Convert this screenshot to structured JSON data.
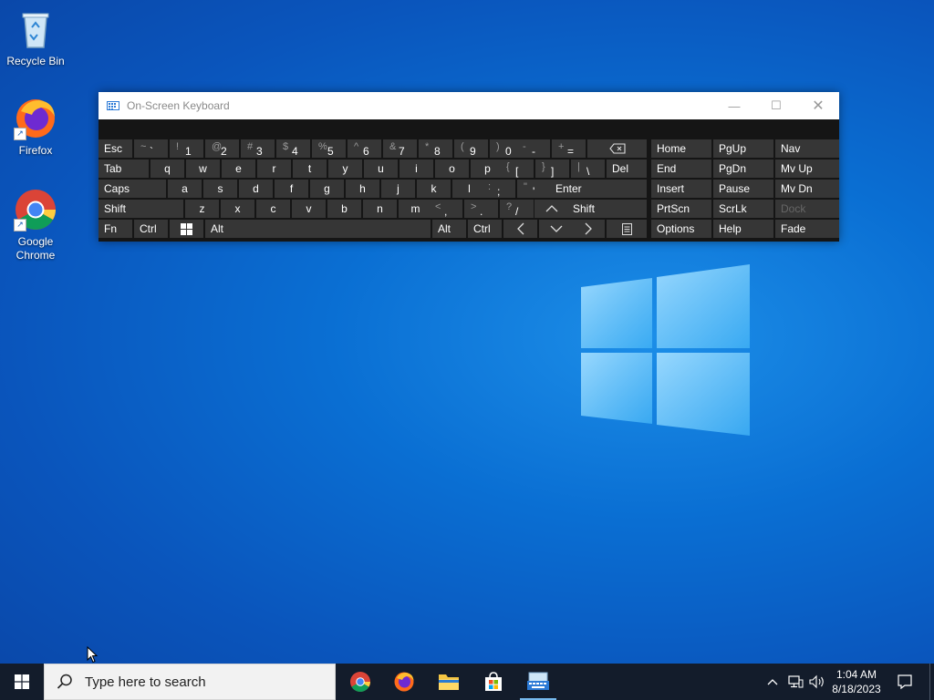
{
  "desktop": {
    "icons": [
      {
        "label": "Recycle Bin"
      },
      {
        "label": "Firefox"
      },
      {
        "label": "Google Chrome"
      }
    ]
  },
  "osk": {
    "title": "On-Screen Keyboard",
    "rows": {
      "r1": {
        "esc": "Esc",
        "tilde": [
          "~",
          "`"
        ],
        "d1": [
          "!",
          "1"
        ],
        "d2": [
          "@",
          "2"
        ],
        "d3": [
          "#",
          "3"
        ],
        "d4": [
          "$",
          "4"
        ],
        "d5": [
          "%",
          "5"
        ],
        "d6": [
          "^",
          "6"
        ],
        "d7": [
          "&",
          "7"
        ],
        "d8": [
          "*",
          "8"
        ],
        "d9": [
          "(",
          "9"
        ],
        "d0": [
          ")",
          "0"
        ],
        "minus": [
          "-",
          "-"
        ],
        "equals": [
          "+",
          "="
        ],
        "home": "Home",
        "pgup": "PgUp",
        "nav": "Nav"
      },
      "r2": {
        "tab": "Tab",
        "q": "q",
        "w": "w",
        "e": "e",
        "r": "r",
        "t": "t",
        "y": "y",
        "u": "u",
        "i": "i",
        "o": "o",
        "p": "p",
        "lbrace": [
          "{",
          "["
        ],
        "rbrace": [
          "}",
          "]"
        ],
        "pipe": [
          "|",
          "\\"
        ],
        "del": "Del",
        "end": "End",
        "pgdn": "PgDn",
        "mvup": "Mv Up"
      },
      "r3": {
        "caps": "Caps",
        "a": "a",
        "s": "s",
        "d": "d",
        "f": "f",
        "g": "g",
        "h": "h",
        "j": "j",
        "k": "k",
        "l": "l",
        "semi": [
          ":",
          ";"
        ],
        "quote": [
          "\"",
          "'"
        ],
        "enter": "Enter",
        "insert": "Insert",
        "pause": "Pause",
        "mvdn": "Mv Dn"
      },
      "r4": {
        "shift_l": "Shift",
        "z": "z",
        "x": "x",
        "c": "c",
        "v": "v",
        "b": "b",
        "n": "n",
        "m": "m",
        "comma": [
          "<",
          ","
        ],
        "period": [
          ">",
          "."
        ],
        "slash": [
          "?",
          "/"
        ],
        "shift_r": "Shift",
        "prtscn": "PrtScn",
        "scrlk": "ScrLk",
        "dock": "Dock"
      },
      "r5": {
        "fn": "Fn",
        "ctrl_l": "Ctrl",
        "alt_l": "Alt",
        "alt_r": "Alt",
        "ctrl_r": "Ctrl",
        "options": "Options",
        "help": "Help",
        "fade": "Fade"
      }
    }
  },
  "taskbar": {
    "search_placeholder": "Type here to search",
    "clock_time": "1:04 AM",
    "clock_date": "8/18/2023"
  }
}
